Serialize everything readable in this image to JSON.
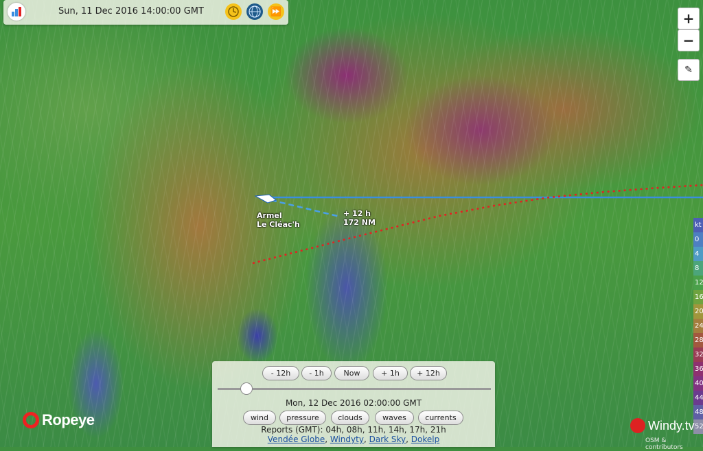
{
  "header": {
    "datetime": "Sun, 11 Dec 2016 14:00:00 GMT",
    "icons": [
      "app-logo-icon",
      "clock-icon",
      "globe-icon",
      "fast-forward-icon"
    ]
  },
  "map_controls": {
    "zoom_in": "+",
    "zoom_out": "−",
    "ruler_icon": "ruler-icon"
  },
  "boat": {
    "name_line1": "Armel",
    "name_line2": "Le Cléac'h",
    "projection_time": "+ 12 h",
    "projection_distance": "172 NM"
  },
  "legend": {
    "unit": "kt",
    "values": [
      "0",
      "4",
      "8",
      "12",
      "16",
      "20",
      "24",
      "28",
      "32",
      "36",
      "40",
      "44",
      "48",
      "52",
      "56"
    ],
    "colors": [
      "#4d5fb5",
      "#4e7fc2",
      "#4f9bc5",
      "#4ca57b",
      "#4aa04a",
      "#6fa33f",
      "#a1963c",
      "#a57e3f",
      "#a3583f",
      "#9a3c55",
      "#8e3170",
      "#823382",
      "#6b3b8f",
      "#5f5fa5",
      "#8e8ea8"
    ]
  },
  "time_controls": {
    "buttons": [
      "- 12h",
      "- 1h",
      "Now",
      "+ 1h",
      "+ 12h"
    ],
    "forecast_time": "Mon, 12 Dec 2016 02:00:00 GMT",
    "slider_position": 0.11
  },
  "layers": {
    "buttons": [
      "wind",
      "pressure",
      "clouds",
      "waves",
      "currents"
    ]
  },
  "reports": {
    "text": "Reports (GMT): 04h, 08h, 11h, 14h, 17h, 21h",
    "links": [
      "Vendée Globe",
      "Windyty",
      "Dark Sky",
      "Dokelp"
    ]
  },
  "branding": {
    "ropeye": "Ropeye",
    "windy": "Windy.tv",
    "attribution": "OSM & contributors"
  },
  "colors": {
    "route_blue": "#3a8ee0",
    "track_red": "#e22222",
    "accent_red": "#e22222"
  }
}
